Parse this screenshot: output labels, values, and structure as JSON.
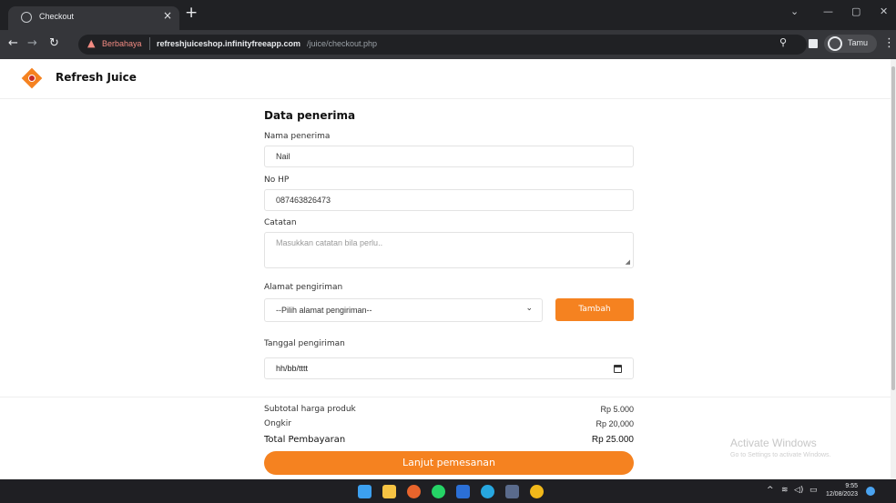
{
  "browser": {
    "tab_title": "Checkout",
    "tab_close": "×",
    "new_tab": "+",
    "security_warning": "Berbahaya",
    "url_host": "refreshjuiceshop.infinityfreeapp.com",
    "url_path": "/juice/checkout.php",
    "profile_label": "Tamu"
  },
  "brand": {
    "name": "Refresh Juice",
    "accent": "#f58220"
  },
  "form": {
    "title": "Data penerima",
    "name_label": "Nama penerima",
    "name_value": "Nail",
    "phone_label": "No HP",
    "phone_value": "087463826473",
    "notes_label": "Catatan",
    "notes_placeholder": "Masukkan catatan bila perlu..",
    "address_label": "Alamat pengiriman",
    "address_selected": "--Pilih alamat pengiriman--",
    "add_button": "Tambah",
    "date_label": "Tanggal pengiriman",
    "date_value": "hh/bb/tttt"
  },
  "summary": {
    "subtotal_label": "Subtotal harga produk",
    "subtotal_value": "Rp 5.000",
    "shipping_label": "Ongkir",
    "shipping_value": "Rp 20,000",
    "total_label": "Total Pembayaran",
    "total_value": "Rp 25.000",
    "continue_button": "Lanjut pemesanan"
  },
  "watermark": {
    "title": "Activate Windows",
    "subtitle": "Go to Settings to activate Windows."
  },
  "taskbar": {
    "time": "9:55",
    "date": "12/08/2023",
    "icons": [
      "start-icon",
      "file-explorer-icon",
      "firefox-icon",
      "whatsapp-icon",
      "word-icon",
      "edge-icon",
      "store-icon",
      "chrome-icon"
    ]
  }
}
